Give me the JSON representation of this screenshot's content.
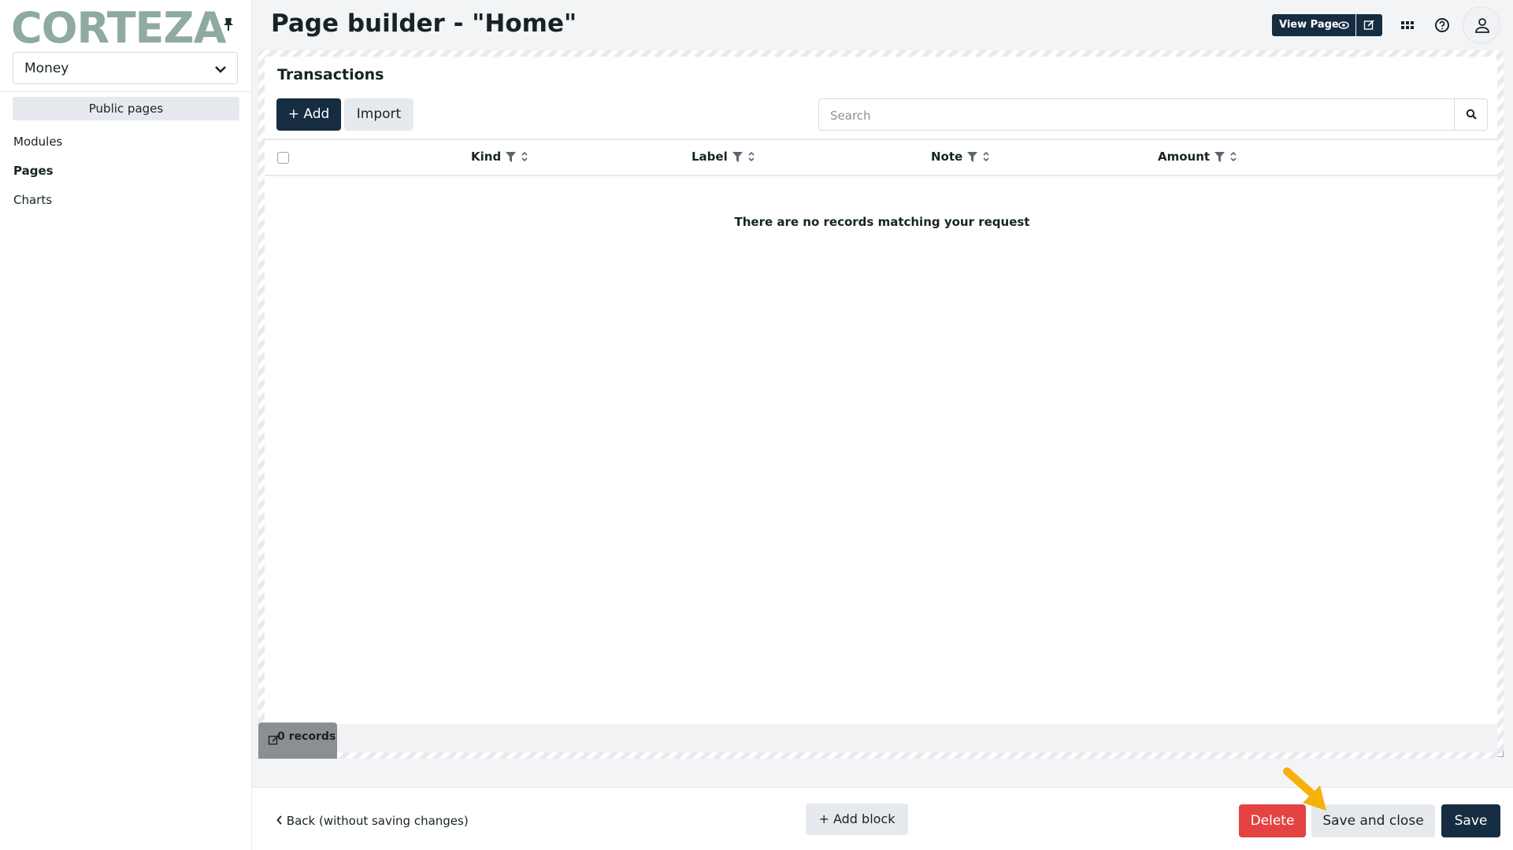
{
  "brand": {
    "logo_text": "CORTEZA"
  },
  "sidebar": {
    "namespace": "Money",
    "public_pages_label": "Public pages",
    "items": [
      {
        "label": "Modules"
      },
      {
        "label": "Pages"
      },
      {
        "label": "Charts"
      }
    ]
  },
  "header": {
    "title": "Page builder - \"Home\"",
    "view_page_label": "View Page"
  },
  "block": {
    "title": "Transactions",
    "add_label": "+ Add",
    "import_label": "Import",
    "search_placeholder": "Search",
    "columns": [
      "Kind",
      "Label",
      "Note",
      "Amount"
    ],
    "empty_message": "There are no records matching your request",
    "records_count": "0 records"
  },
  "footer": {
    "back_label": "Back (without saving changes)",
    "add_block_label": "+ Add block",
    "delete_label": "Delete",
    "save_close_label": "Save and close",
    "save_label": "Save"
  }
}
